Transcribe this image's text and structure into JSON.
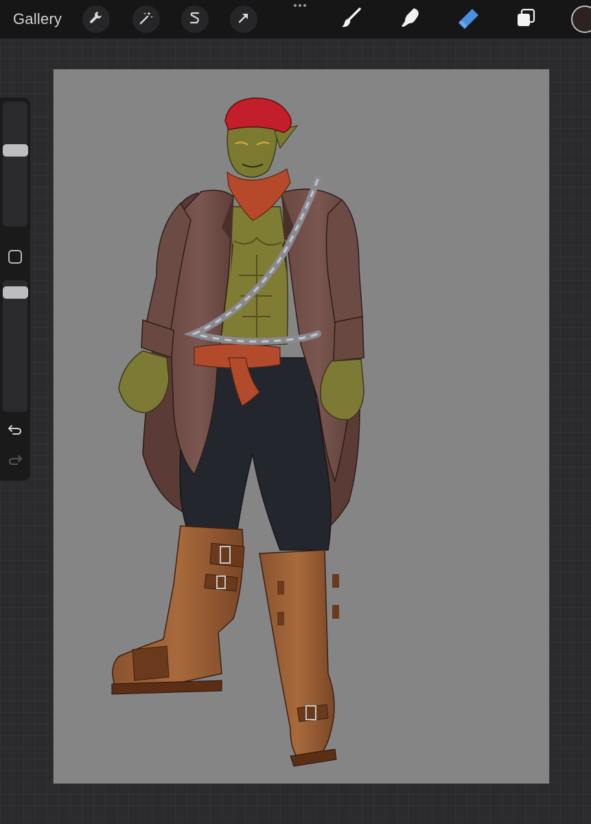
{
  "toolbar": {
    "gallery_label": "Gallery",
    "left_tools": [
      {
        "name": "actions",
        "icon": "wrench-icon"
      },
      {
        "name": "adjustments",
        "icon": "magic-wand-icon"
      },
      {
        "name": "selection",
        "icon": "selection-s-icon"
      },
      {
        "name": "transform",
        "icon": "arrow-cursor-icon"
      }
    ],
    "more_icon": "more-dots-icon",
    "right_tools": [
      {
        "name": "brush",
        "icon": "brush-icon",
        "active": false
      },
      {
        "name": "smudge",
        "icon": "smudge-icon",
        "active": false
      },
      {
        "name": "eraser",
        "icon": "eraser-icon",
        "active": true
      },
      {
        "name": "layers",
        "icon": "layers-icon",
        "active": false
      }
    ],
    "current_color": "#2e2220",
    "active_tool_color": "#4a90e2"
  },
  "sidebar": {
    "brush_size_level": 0.62,
    "opacity_level": 0.95,
    "modifier_icon": "square-modifier-icon",
    "undo_icon": "undo-icon",
    "redo_icon": "redo-icon",
    "redo_enabled": false
  },
  "canvas": {
    "background_color": "#858585",
    "artwork": "character-illustration"
  }
}
